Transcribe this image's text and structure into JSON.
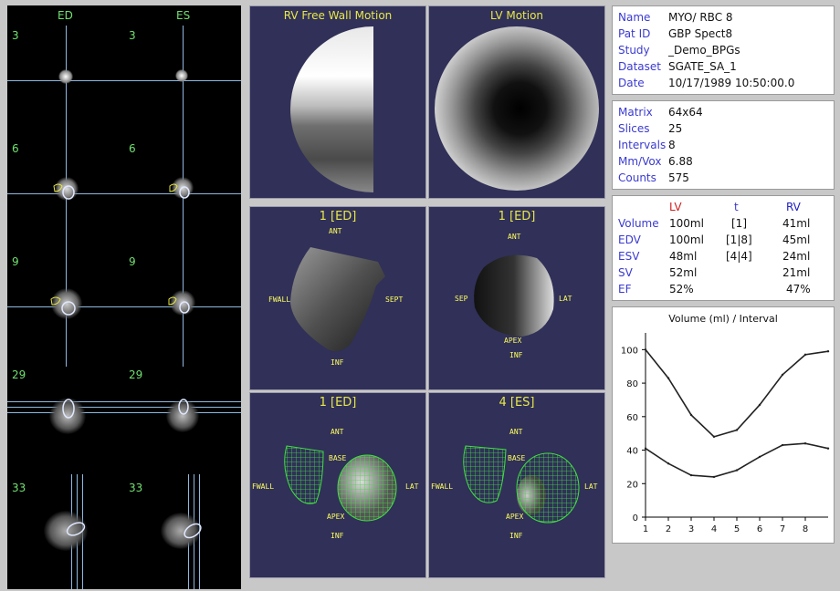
{
  "images": {
    "ed_label": "ED",
    "es_label": "ES",
    "slices": [
      "3",
      "6",
      "9",
      "29",
      "33"
    ]
  },
  "panels": {
    "rv_title": "RV Free Wall Motion",
    "lv_title": "LV Motion",
    "ed1": "1 [ED]",
    "ed2": "1 [ED]",
    "ed3": "1 [ED]",
    "es4": "4 [ES]",
    "lbl_ant": "ANT",
    "lbl_inf": "INF",
    "lbl_apex": "APEX",
    "lbl_fwall": "FWALL",
    "lbl_sept": "SEPT",
    "lbl_sep": "SEP",
    "lbl_lat": "LAT",
    "lbl_base": "BASE"
  },
  "patient": [
    {
      "key": "Name",
      "value": "MYO/ RBC 8"
    },
    {
      "key": "Pat ID",
      "value": "GBP Spect8"
    },
    {
      "key": "Study",
      "value": "_Demo_BPGs"
    },
    {
      "key": "Dataset",
      "value": "SGATE_SA_1"
    },
    {
      "key": "Date",
      "value": "10/17/1989 10:50:00.0"
    }
  ],
  "acquisition": [
    {
      "key": "Matrix",
      "value": "64x64"
    },
    {
      "key": "Slices",
      "value": "25"
    },
    {
      "key": "Intervals",
      "value": "8"
    },
    {
      "key": "Mm/Vox",
      "value": "6.88"
    },
    {
      "key": "Counts",
      "value": "575"
    }
  ],
  "results": {
    "headers": {
      "lv": "LV",
      "t": "t",
      "rv": "RV"
    },
    "header_colors": {
      "lv": "#d02020",
      "t": "#3a3ad0",
      "rv": "#2020c0"
    },
    "rows": [
      {
        "key": "Volume",
        "lv": "100ml",
        "t": "[1]",
        "rv": "41ml"
      },
      {
        "key": "EDV",
        "lv": "100ml",
        "t": "[1|8]",
        "rv": "45ml"
      },
      {
        "key": "ESV",
        "lv": "48ml",
        "t": "[4|4]",
        "rv": "24ml"
      },
      {
        "key": "SV",
        "lv": "52ml",
        "t": "",
        "rv": "21ml"
      },
      {
        "key": "EF",
        "lv": "52%",
        "t": "",
        "rv": "47%"
      }
    ]
  },
  "chart_data": {
    "type": "line",
    "title": "Volume (ml) / Interval",
    "x": [
      1,
      2,
      3,
      4,
      5,
      6,
      7,
      8,
      9
    ],
    "xticks": [
      1,
      2,
      3,
      4,
      5,
      6,
      7,
      8
    ],
    "yticks": [
      0,
      20,
      40,
      60,
      80,
      100
    ],
    "ylim": [
      0,
      110
    ],
    "xlim": [
      1,
      9
    ],
    "series": [
      {
        "values": [
          100,
          83,
          61,
          48,
          52,
          67,
          85,
          97,
          99
        ]
      },
      {
        "values": [
          41,
          32,
          25,
          24,
          28,
          36,
          43,
          44,
          41
        ]
      }
    ]
  }
}
